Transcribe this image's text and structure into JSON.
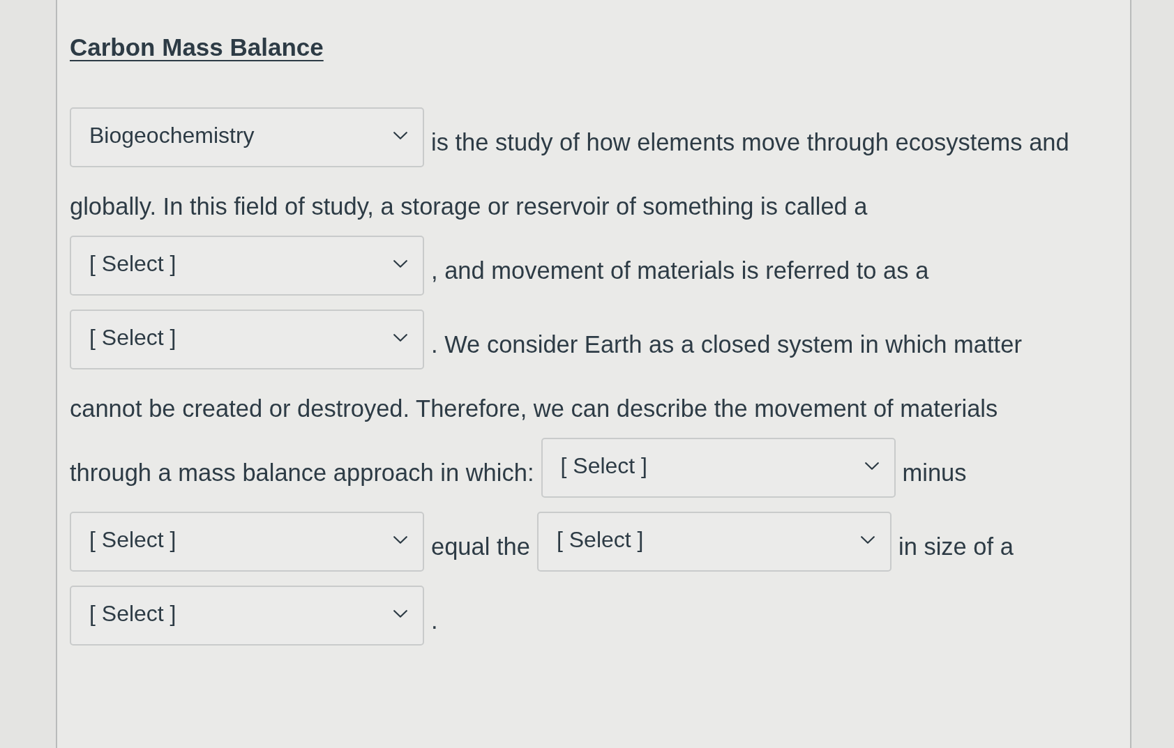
{
  "title": "Carbon Mass Balance",
  "question": {
    "lines": [
      {
        "parts": [
          {
            "kind": "dropdown",
            "value": "Biogeochemistry"
          },
          {
            "kind": "text",
            "text": "is the study of how elements move through ecosystems and"
          }
        ]
      },
      {
        "parts": [
          {
            "kind": "text",
            "text": "globally. In this field of study, a storage or reservoir of something is called a"
          }
        ]
      },
      {
        "parts": [
          {
            "kind": "dropdown",
            "value": "[ Select ]"
          },
          {
            "kind": "text",
            "text": ", and movement of materials is referred to as a"
          }
        ]
      },
      {
        "parts": [
          {
            "kind": "dropdown",
            "value": "[ Select ]"
          },
          {
            "kind": "text",
            "text": ". We consider Earth as a closed system in which matter"
          }
        ]
      },
      {
        "parts": [
          {
            "kind": "text",
            "text": "cannot be created or destroyed. Therefore, we can describe the movement of materials"
          }
        ]
      },
      {
        "parts": [
          {
            "kind": "text",
            "text": "through a mass balance approach in which:"
          },
          {
            "kind": "dropdown",
            "value": "[ Select ]"
          },
          {
            "kind": "text",
            "text": "minus"
          }
        ]
      },
      {
        "parts": [
          {
            "kind": "dropdown",
            "value": "[ Select ]"
          },
          {
            "kind": "text",
            "text": "equal the"
          },
          {
            "kind": "dropdown",
            "value": "[ Select ]"
          },
          {
            "kind": "text",
            "text": "in size of a"
          }
        ]
      },
      {
        "parts": [
          {
            "kind": "dropdown",
            "value": "[ Select ]"
          },
          {
            "kind": "text",
            "text": "."
          }
        ]
      }
    ]
  }
}
